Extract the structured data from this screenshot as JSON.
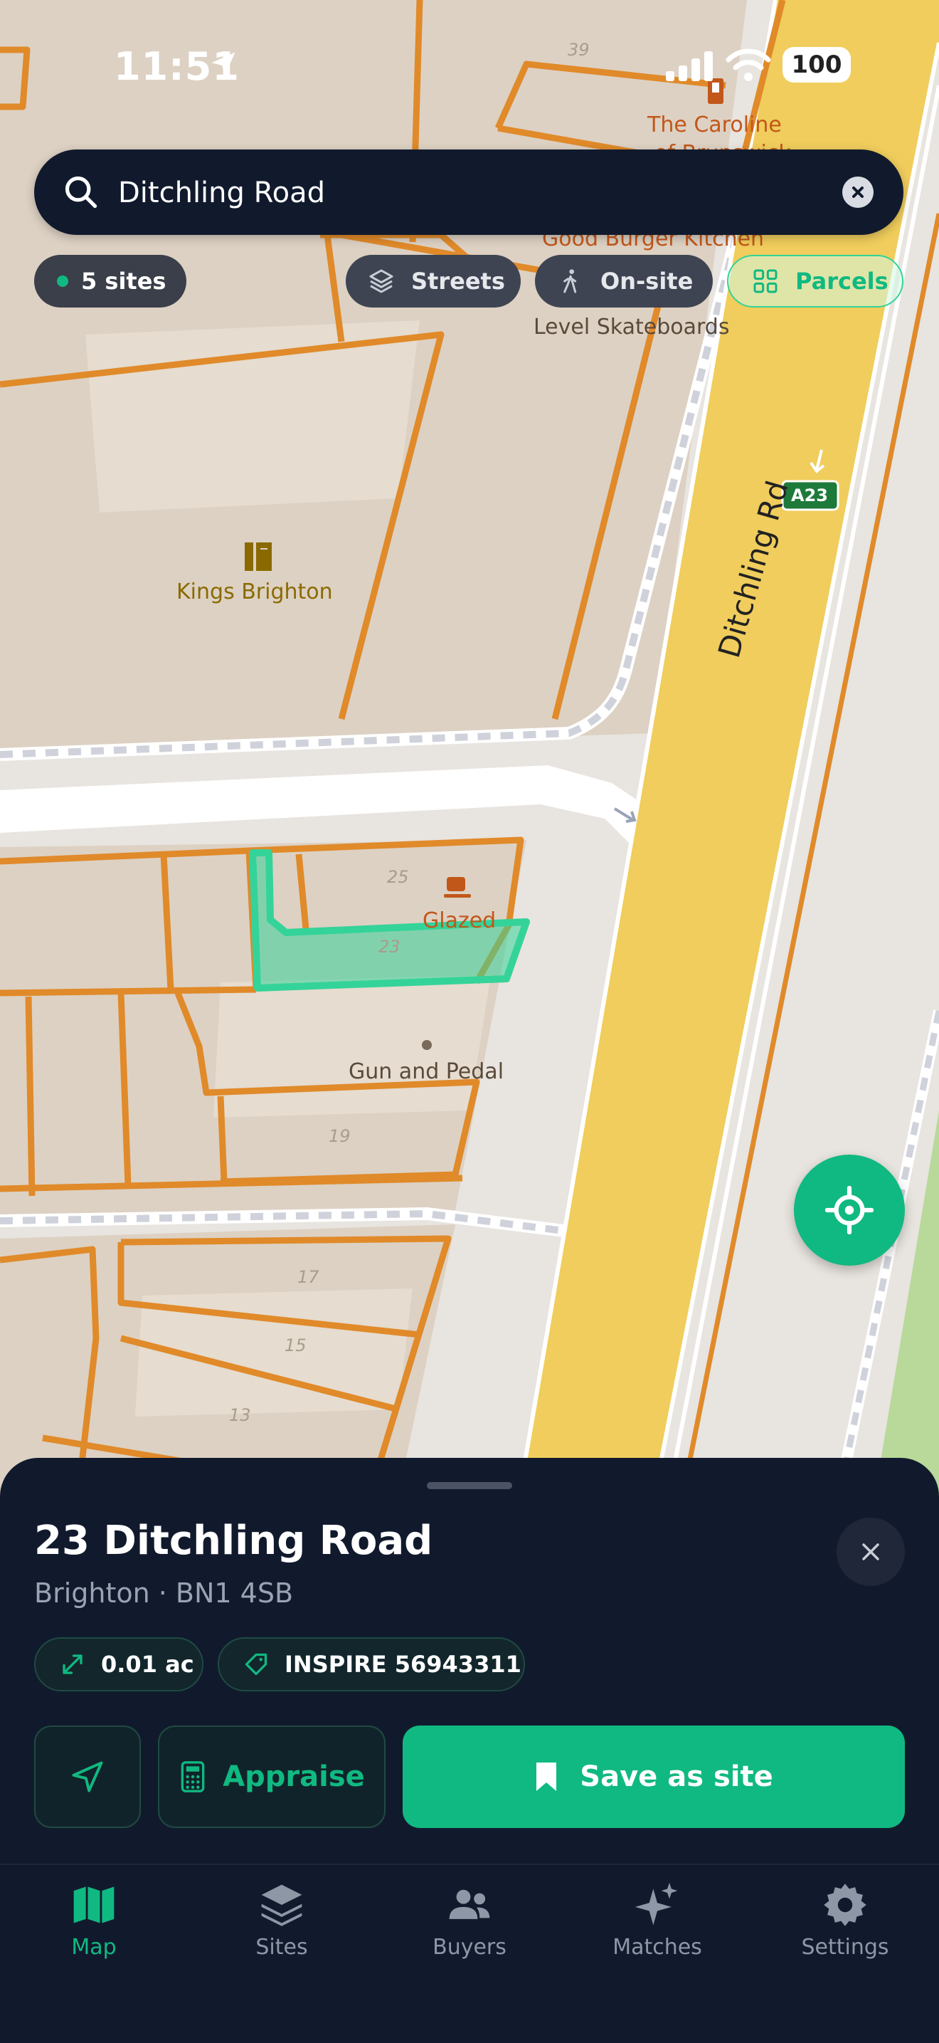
{
  "status_bar": {
    "time": "11:51",
    "battery": "100"
  },
  "search": {
    "value": "Ditchling Road"
  },
  "chips": {
    "sites": "5 sites",
    "streets": "Streets",
    "onsite": "On-site",
    "parcels": "Parcels"
  },
  "map": {
    "road_label": "Ditchling Rd",
    "road_shield": "A23",
    "pois": {
      "caroline": "The Caroline",
      "caroline_2": "of Brunswick",
      "good_burger": "Good Burger Kitchen",
      "level_skate": "Level Skateboards",
      "kings": "Kings Brighton",
      "glazed": "Glazed",
      "gun": "Gun and Pedal"
    },
    "house_numbers": {
      "n39": "39",
      "n25": "25",
      "n23": "23",
      "n19": "19",
      "n17": "17",
      "n15": "15",
      "n13": "13"
    }
  },
  "sheet": {
    "title": "23 Ditchling Road",
    "subtitle": "Brighton · BN1 4SB",
    "area": "0.01 ac",
    "inspire": "INSPIRE 56943311",
    "appraise": "Appraise",
    "save": "Save as site"
  },
  "tabs": [
    "Map",
    "Sites",
    "Buyers",
    "Matches",
    "Settings"
  ],
  "colors": {
    "accent": "#10b981",
    "sheet_bg": "#111a2d",
    "parcel": "#e08a2a",
    "road": "#f0cd5c"
  }
}
